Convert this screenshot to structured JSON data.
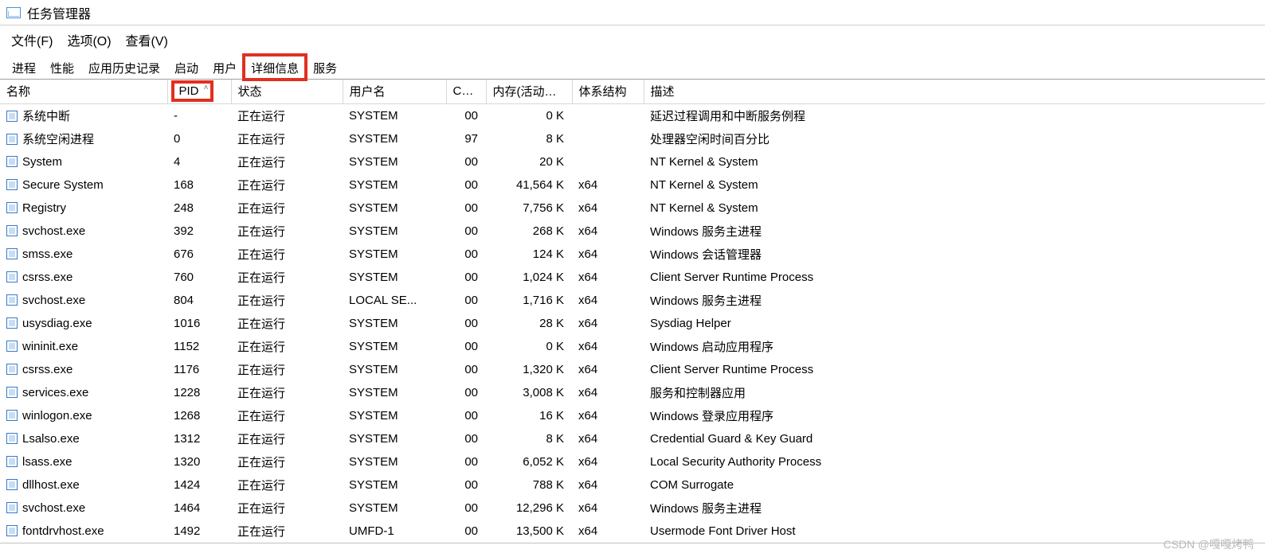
{
  "window": {
    "title": "任务管理器"
  },
  "menu": {
    "file": "文件(F)",
    "options": "选项(O)",
    "view": "查看(V)"
  },
  "tabs": {
    "processes": "进程",
    "performance": "性能",
    "app_history": "应用历史记录",
    "startup": "启动",
    "users": "用户",
    "details": "详细信息",
    "services": "服务"
  },
  "columns": {
    "name": "名称",
    "pid": "PID",
    "state": "状态",
    "user": "用户名",
    "cpu": "CPU",
    "mem": "内存(活动的...",
    "arch": "体系结构",
    "desc": "描述"
  },
  "rows": [
    {
      "name": "系统中断",
      "pid": "-",
      "state": "正在运行",
      "user": "SYSTEM",
      "cpu": "00",
      "mem": "0 K",
      "arch": "",
      "desc": "延迟过程调用和中断服务例程"
    },
    {
      "name": "系统空闲进程",
      "pid": "0",
      "state": "正在运行",
      "user": "SYSTEM",
      "cpu": "97",
      "mem": "8 K",
      "arch": "",
      "desc": "处理器空闲时间百分比"
    },
    {
      "name": "System",
      "pid": "4",
      "state": "正在运行",
      "user": "SYSTEM",
      "cpu": "00",
      "mem": "20 K",
      "arch": "",
      "desc": "NT Kernel & System"
    },
    {
      "name": "Secure System",
      "pid": "168",
      "state": "正在运行",
      "user": "SYSTEM",
      "cpu": "00",
      "mem": "41,564 K",
      "arch": "x64",
      "desc": "NT Kernel & System"
    },
    {
      "name": "Registry",
      "pid": "248",
      "state": "正在运行",
      "user": "SYSTEM",
      "cpu": "00",
      "mem": "7,756 K",
      "arch": "x64",
      "desc": "NT Kernel & System"
    },
    {
      "name": "svchost.exe",
      "pid": "392",
      "state": "正在运行",
      "user": "SYSTEM",
      "cpu": "00",
      "mem": "268 K",
      "arch": "x64",
      "desc": "Windows 服务主进程"
    },
    {
      "name": "smss.exe",
      "pid": "676",
      "state": "正在运行",
      "user": "SYSTEM",
      "cpu": "00",
      "mem": "124 K",
      "arch": "x64",
      "desc": "Windows 会话管理器"
    },
    {
      "name": "csrss.exe",
      "pid": "760",
      "state": "正在运行",
      "user": "SYSTEM",
      "cpu": "00",
      "mem": "1,024 K",
      "arch": "x64",
      "desc": "Client Server Runtime Process"
    },
    {
      "name": "svchost.exe",
      "pid": "804",
      "state": "正在运行",
      "user": "LOCAL SE...",
      "cpu": "00",
      "mem": "1,716 K",
      "arch": "x64",
      "desc": "Windows 服务主进程"
    },
    {
      "name": "usysdiag.exe",
      "pid": "1016",
      "state": "正在运行",
      "user": "SYSTEM",
      "cpu": "00",
      "mem": "28 K",
      "arch": "x64",
      "desc": "Sysdiag Helper"
    },
    {
      "name": "wininit.exe",
      "pid": "1152",
      "state": "正在运行",
      "user": "SYSTEM",
      "cpu": "00",
      "mem": "0 K",
      "arch": "x64",
      "desc": "Windows 启动应用程序"
    },
    {
      "name": "csrss.exe",
      "pid": "1176",
      "state": "正在运行",
      "user": "SYSTEM",
      "cpu": "00",
      "mem": "1,320 K",
      "arch": "x64",
      "desc": "Client Server Runtime Process"
    },
    {
      "name": "services.exe",
      "pid": "1228",
      "state": "正在运行",
      "user": "SYSTEM",
      "cpu": "00",
      "mem": "3,008 K",
      "arch": "x64",
      "desc": "服务和控制器应用"
    },
    {
      "name": "winlogon.exe",
      "pid": "1268",
      "state": "正在运行",
      "user": "SYSTEM",
      "cpu": "00",
      "mem": "16 K",
      "arch": "x64",
      "desc": "Windows 登录应用程序"
    },
    {
      "name": "Lsalso.exe",
      "pid": "1312",
      "state": "正在运行",
      "user": "SYSTEM",
      "cpu": "00",
      "mem": "8 K",
      "arch": "x64",
      "desc": "Credential Guard & Key Guard"
    },
    {
      "name": "lsass.exe",
      "pid": "1320",
      "state": "正在运行",
      "user": "SYSTEM",
      "cpu": "00",
      "mem": "6,052 K",
      "arch": "x64",
      "desc": "Local Security Authority Process"
    },
    {
      "name": "dllhost.exe",
      "pid": "1424",
      "state": "正在运行",
      "user": "SYSTEM",
      "cpu": "00",
      "mem": "788 K",
      "arch": "x64",
      "desc": "COM Surrogate"
    },
    {
      "name": "svchost.exe",
      "pid": "1464",
      "state": "正在运行",
      "user": "SYSTEM",
      "cpu": "00",
      "mem": "12,296 K",
      "arch": "x64",
      "desc": "Windows 服务主进程"
    },
    {
      "name": "fontdrvhost.exe",
      "pid": "1492",
      "state": "正在运行",
      "user": "UMFD-1",
      "cpu": "00",
      "mem": "13,500 K",
      "arch": "x64",
      "desc": "Usermode Font Driver Host"
    }
  ],
  "watermark": "CSDN @嘎嘎烤鸭"
}
